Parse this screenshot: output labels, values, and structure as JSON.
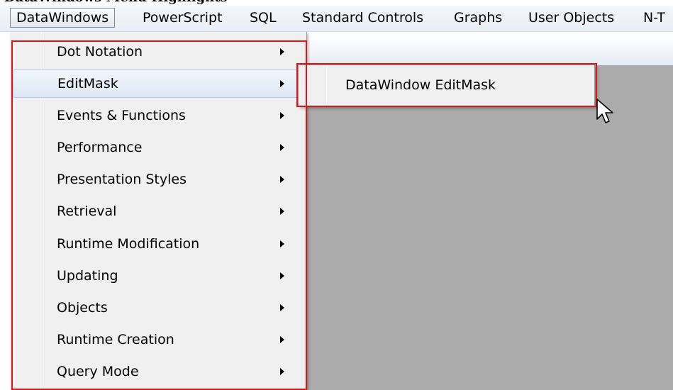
{
  "menubar": {
    "items": [
      {
        "label": "DataWindows",
        "active": true
      },
      {
        "label": "PowerScript",
        "active": false
      },
      {
        "label": "SQL",
        "active": false
      },
      {
        "label": "Standard Controls",
        "active": false
      },
      {
        "label": "Graphs",
        "active": false
      },
      {
        "label": "User Objects",
        "active": false
      },
      {
        "label": "N-T",
        "active": false
      }
    ]
  },
  "dropdown": {
    "items": [
      {
        "label": "Dot Notation",
        "has_submenu": true
      },
      {
        "label": "EditMask",
        "has_submenu": true,
        "highlighted": true
      },
      {
        "label": "Events & Functions",
        "has_submenu": true
      },
      {
        "label": "Performance",
        "has_submenu": true
      },
      {
        "label": "Presentation Styles",
        "has_submenu": true
      },
      {
        "label": "Retrieval",
        "has_submenu": true
      },
      {
        "label": "Runtime Modification",
        "has_submenu": true
      },
      {
        "label": "Updating",
        "has_submenu": true
      },
      {
        "label": "Objects",
        "has_submenu": true
      },
      {
        "label": "Runtime Creation",
        "has_submenu": true
      },
      {
        "label": "Query Mode",
        "has_submenu": true
      }
    ]
  },
  "submenu": {
    "items": [
      {
        "label": "DataWindow EditMask"
      }
    ]
  },
  "colors": {
    "callout": "#e01414",
    "workspace": "#ababab",
    "menu_background": "#f0f0f0",
    "highlight_border": "#aecbf1"
  },
  "icons": {
    "submenu_arrow": "triangle-right",
    "cursor": "arrow-pointer"
  }
}
